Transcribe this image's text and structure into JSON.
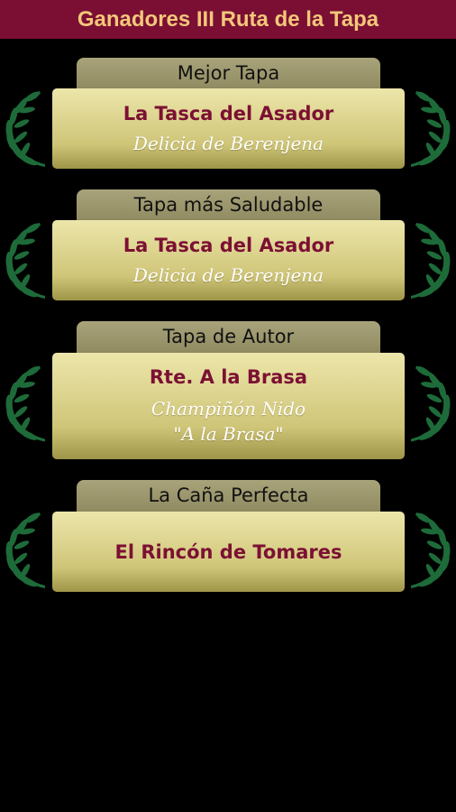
{
  "header": {
    "title": "Ganadores III Ruta de la Tapa"
  },
  "colors": {
    "header_bg": "#7a0f33",
    "header_text": "#f3c77a",
    "venue_text": "#7c1033",
    "laurel": "#1e6b3a"
  },
  "awards": [
    {
      "category": "Mejor Tapa",
      "venue": "La Tasca del Asador",
      "dish": "Delicia de Berenjena"
    },
    {
      "category": "Tapa más Saludable",
      "venue": "La Tasca del Asador",
      "dish": "Delicia de Berenjena"
    },
    {
      "category": "Tapa de Autor",
      "venue": "Rte. A la Brasa",
      "dish": "Champiñón Nido\n\"A la Brasa\""
    },
    {
      "category": "La Caña Perfecta",
      "venue": "El Rincón de Tomares",
      "dish": ""
    }
  ],
  "icons": {
    "laurel": "laurel-branch-icon"
  }
}
